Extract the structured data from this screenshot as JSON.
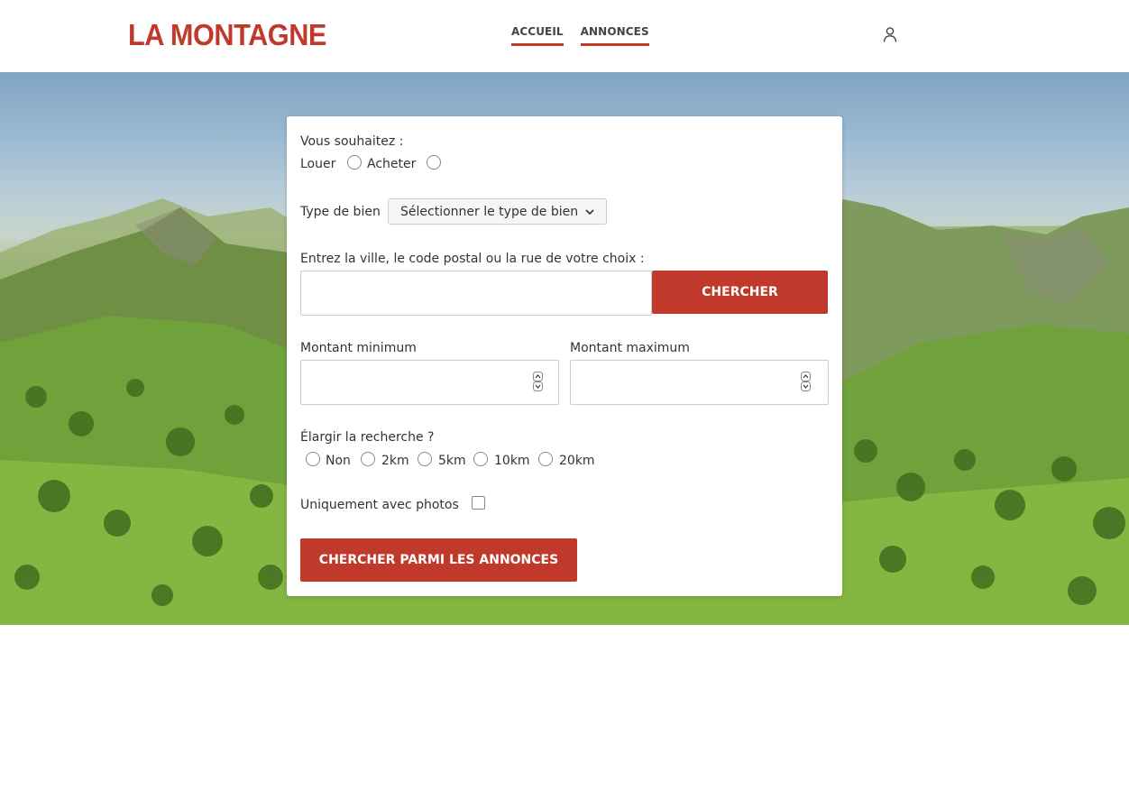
{
  "header": {
    "logo": "LA MONTAGNE",
    "nav": [
      "ACCUEIL",
      "ANNONCES"
    ],
    "accent_color": "#c0392b"
  },
  "form": {
    "intent_label": "Vous souhaitez :",
    "intent_options": [
      "Louer",
      "Acheter"
    ],
    "property_type_label": "Type de bien",
    "property_type_select": "Sélectionner le type de bien",
    "location_label": "Entrez la ville, le code postal ou la rue de votre choix :",
    "location_value": "",
    "search_button": "CHERCHER",
    "min_amount_label": "Montant minimum",
    "max_amount_label": "Montant maximum",
    "min_amount_value": "",
    "max_amount_value": "",
    "radius_label": "Élargir la recherche ?",
    "radius_options": [
      "Non",
      "2km",
      "5km",
      "10km",
      "20km"
    ],
    "photos_only_label": "Uniquement avec photos",
    "submit_button": "CHERCHER PARMI LES ANNONCES"
  }
}
